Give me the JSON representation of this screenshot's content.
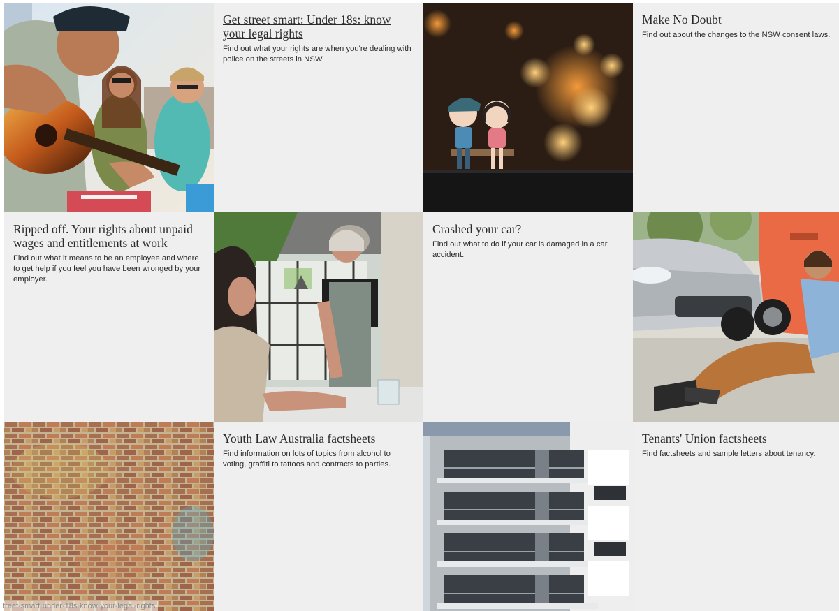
{
  "cards": [
    {
      "title": "Get street smart: Under 18s: know your legal rights",
      "desc": "Find out what your rights are when you're dealing with police on the streets in NSW.",
      "image": "friends-with-guitar-photo"
    },
    {
      "title": "Make No Doubt",
      "desc": "Find out about the changes to the NSW consent laws.",
      "image": "figurines-kissing-photo"
    },
    {
      "title": "Ripped off. Your rights about unpaid wages and entitlements at work",
      "desc": "Find out what it means to be an employee and where to get help if you feel you have been wronged by your employer.",
      "image": "waitress-serving-photo"
    },
    {
      "title": "Crashed your car?",
      "desc": "Find out what to do if your car is damaged in a car accident.",
      "image": "car-accident-photo"
    },
    {
      "title": "Youth Law Australia factsheets",
      "desc": "Find information on lots of topics from alcohol to voting, graffiti to tattoos and contracts to parties.",
      "image": "brick-wall-photo"
    },
    {
      "title": "Tenants' Union factsheets",
      "desc": "Find factsheets and sample letters about tenancy.",
      "image": "apartment-building-photo"
    }
  ],
  "status_url": "treet-smart-under-18s-know-your-legal-rights"
}
